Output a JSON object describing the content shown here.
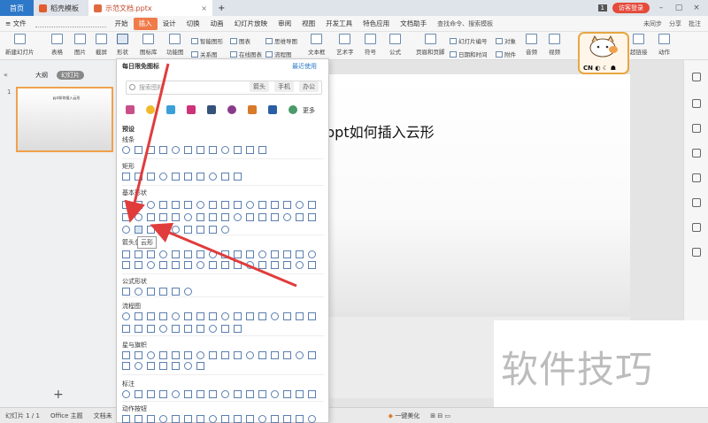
{
  "titlebar": {
    "home_tab": "首页",
    "tabs": [
      {
        "label": "稻壳模板"
      },
      {
        "label": "示范文档.pptx"
      }
    ],
    "new_tab": "+",
    "login": "访客登录",
    "page_badge": "1"
  },
  "menubar": {
    "file": "≡ 文件",
    "items": [
      "开始",
      "插入",
      "设计",
      "切换",
      "动画",
      "幻灯片放映",
      "审阅",
      "视图",
      "开发工具",
      "特色应用",
      "文档助手"
    ],
    "active": "插入",
    "search": "查找命令、搜索模板",
    "right": [
      "未同步",
      "分享",
      "批注"
    ]
  },
  "ribbon": {
    "buttons": [
      "新建幻灯片",
      "表格",
      "图片",
      "截屏",
      "形状",
      "图标库",
      "功能图"
    ],
    "small": [
      "智能图形",
      "图表",
      "思维导图",
      "关系图",
      "在线图表",
      "流程图"
    ],
    "more": [
      "文本框",
      "艺术字",
      "符号",
      "公式",
      "页眉和页脚"
    ],
    "right_small": [
      "幻灯片编号",
      "对象",
      "日期和时间",
      "附件"
    ],
    "right_big": [
      "音频",
      "视频",
      "Flash",
      "超链接",
      "动作"
    ]
  },
  "left_panel": {
    "tabs": [
      "大纲",
      "幻灯片"
    ],
    "active_tab": "幻灯片",
    "slide_number": "1",
    "thumb_title": "ppt如何插入云形",
    "add": "+"
  },
  "slide": {
    "title": "ppt如何插入云形"
  },
  "dropdown": {
    "header": "每日限免图标",
    "recent": "最近使用",
    "search_placeholder": "搜索图标",
    "chips": [
      "箭头",
      "手机",
      "办公"
    ],
    "more": "更多",
    "sections": [
      "预设",
      "线条",
      "矩形",
      "基本形状",
      "箭头总汇",
      "公式形状",
      "流程图",
      "星与旗帜",
      "标注",
      "动作按钮"
    ],
    "tooltip": "云形"
  },
  "statusbar": {
    "slide_info": "幻灯片 1 / 1",
    "theme": "Office 主题",
    "doc": "文档未",
    "beautify": "一键美化",
    "zoom_icons": "⊞ ⊟ ▭"
  },
  "watermark": "软件技巧",
  "colors": {
    "accent": "#f07a4a",
    "home_tab": "#2d78c8",
    "arrow": "#e03c3c",
    "selected_border": "#f0a14b"
  }
}
